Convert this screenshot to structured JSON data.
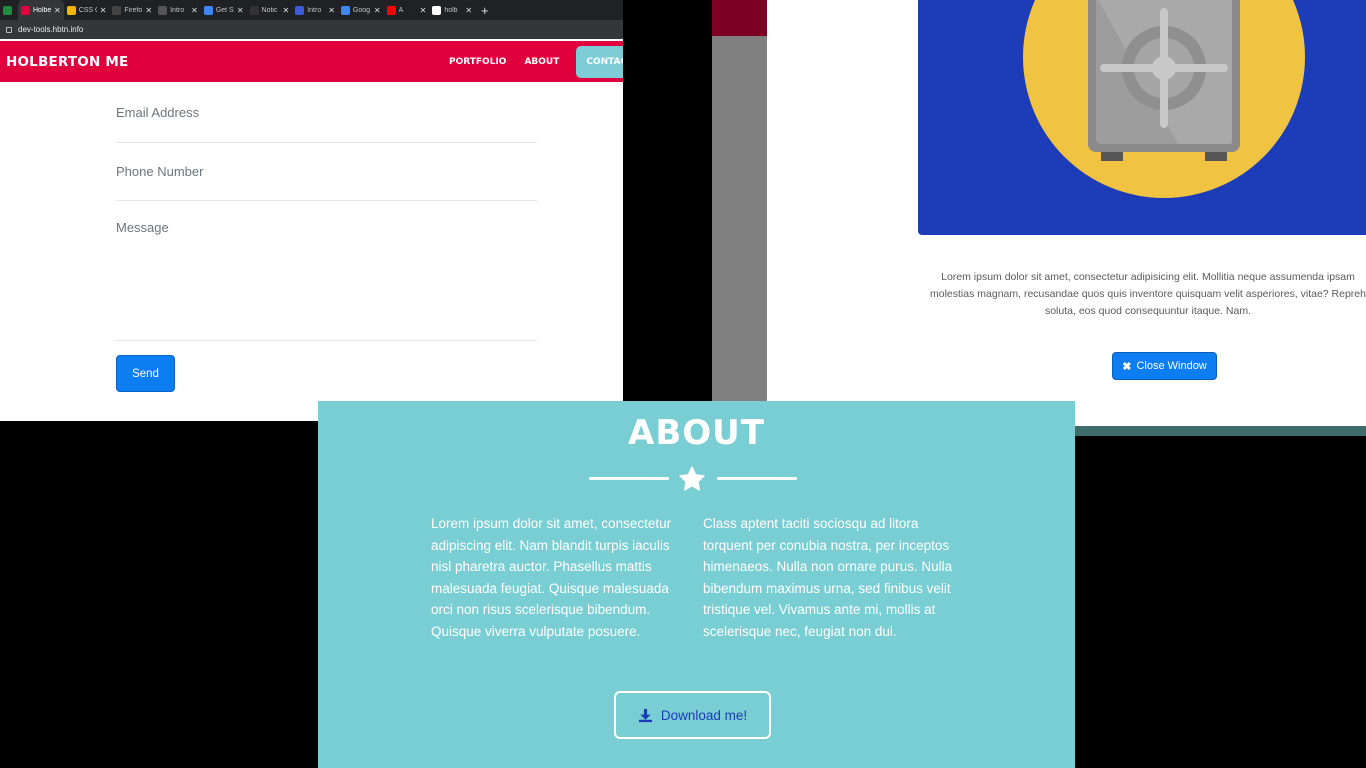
{
  "browser": {
    "tabs": [
      {
        "label": "",
        "favicon_color": "#1e8e3e",
        "active": false
      },
      {
        "label": "Holberton",
        "favicon_color": "#e0003d",
        "active": true
      },
      {
        "label": "CSS C",
        "favicon_color": "#f4b400",
        "active": false
      },
      {
        "label": "Firefox",
        "favicon_color": "#444444",
        "active": false
      },
      {
        "label": "Intro",
        "favicon_color": "#555555",
        "active": false
      },
      {
        "label": "Get St",
        "favicon_color": "#4285f4",
        "active": false
      },
      {
        "label": "Notic",
        "favicon_color": "#333333",
        "active": false
      },
      {
        "label": "Intro",
        "favicon_color": "#3b5bdb",
        "active": false
      },
      {
        "label": "Goog",
        "favicon_color": "#4285f4",
        "active": false
      },
      {
        "label": "A",
        "favicon_color": "#ff0000",
        "active": false
      },
      {
        "label": "holb",
        "favicon_color": "#ffffff",
        "active": false
      }
    ],
    "new_tab": "+",
    "url": "dev-tools.hbtn.info"
  },
  "site": {
    "brand": "HOLBERTON ME",
    "nav": [
      "PORTFOLIO",
      "ABOUT",
      "CONTACT"
    ],
    "active_nav": "CONTACT"
  },
  "contact_form": {
    "email_placeholder": "Email Address",
    "phone_placeholder": "Phone Number",
    "message_placeholder": "Message",
    "send_label": "Send"
  },
  "modal": {
    "text_lines": [
      "Lorem ipsum dolor sit amet, consectetur adipisicing elit. Mollitia neque assumenda ipsam",
      "molestias magnam, recusandae quos quis inventore quisquam velit asperiores, vitae? Repreh",
      "soluta, eos quod consequuntur itaque. Nam."
    ],
    "close_label": "Close Window"
  },
  "about": {
    "title": "ABOUT",
    "col1": "Lorem ipsum dolor sit amet, consectetur adipiscing elit. Nam blandit turpis iaculis nisl pharetra auctor. Phasellus mattis malesuada feugiat. Quisque malesuada orci non risus scelerisque bibendum. Quisque viverra vulputate posuere.",
    "col2": "Class aptent taciti sociosqu ad litora torquent per conubia nostra, per inceptos himenaeos. Nulla non ornare purus. Nulla bibendum maximus urna, sed finibus velit tristique vel. Vivamus ante mi, mollis at scelerisque nec, feugiat non dui.",
    "download_label": "Download me!"
  },
  "colors": {
    "brand_red": "#e0003d",
    "teal": "#79ced4",
    "primary_blue": "#0d7ef1",
    "modal_image_blue": "#1c3cb8",
    "safe_yellow": "#f0c442"
  }
}
